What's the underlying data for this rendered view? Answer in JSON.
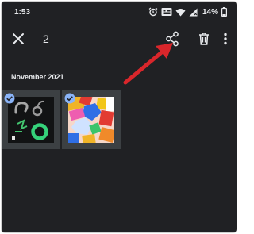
{
  "status_bar": {
    "time": "1:53",
    "battery": "14%",
    "icons": [
      "alarm-icon",
      "media-icon",
      "wifi-icon",
      "signal-icon",
      "battery-icon"
    ]
  },
  "selection_bar": {
    "count": "2",
    "icons": [
      "close-icon",
      "share-icon",
      "trash-icon",
      "more-vert-icon"
    ]
  },
  "gallery": {
    "section_date": "November 2021",
    "items": [
      {
        "selected": true,
        "content": "doodles-and-rings"
      },
      {
        "selected": true,
        "content": "colorful-blocks"
      }
    ]
  },
  "colors": {
    "background": "#202124",
    "thumb_frame": "#3c4043",
    "check_accent": "#8ab4f8",
    "annotation_arrow": "#d9262b"
  }
}
